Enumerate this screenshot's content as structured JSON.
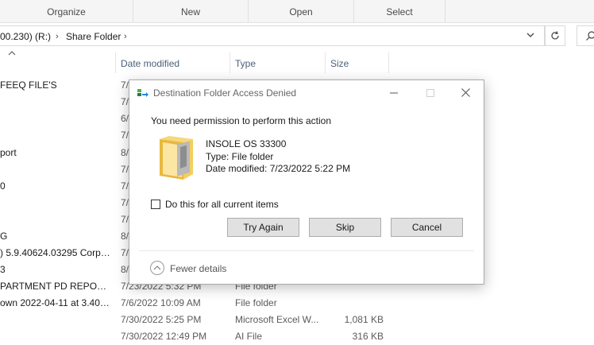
{
  "ribbon": {
    "groups": [
      "Organize",
      "New",
      "Open",
      "Select"
    ]
  },
  "address": {
    "drive_partial": "00.230) (R:)",
    "folder": "Share Folder"
  },
  "columns": {
    "date_modified": "Date modified",
    "type": "Type",
    "size": "Size"
  },
  "files": [
    {
      "name": "FEEQ FILE'S",
      "date": "7/",
      "type": "",
      "size": ""
    },
    {
      "name": "",
      "date": "7/",
      "type": "",
      "size": ""
    },
    {
      "name": "",
      "date": "6/",
      "type": "",
      "size": ""
    },
    {
      "name": "",
      "date": "7/",
      "type": "",
      "size": ""
    },
    {
      "name": "port",
      "date": "8/",
      "type": "",
      "size": ""
    },
    {
      "name": "",
      "date": "7/",
      "type": "",
      "size": ""
    },
    {
      "name": "0",
      "date": "7/",
      "type": "",
      "size": ""
    },
    {
      "name": "",
      "date": "7/",
      "type": "",
      "size": ""
    },
    {
      "name": "",
      "date": "7/",
      "type": "",
      "size": ""
    },
    {
      "name": "G",
      "date": "8/",
      "type": "",
      "size": ""
    },
    {
      "name": ") 5.9.40624.03295 Corpor...",
      "date": "7/",
      "type": "",
      "size": ""
    },
    {
      "name": "3",
      "date": "8/",
      "type": "",
      "size": ""
    },
    {
      "name": "PARTMENT PD REPORTI...",
      "date": "7/23/2022 5:32 PM",
      "type": "File folder",
      "size": ""
    },
    {
      "name": "own 2022-04-11 at 3.40.4...",
      "date": "7/6/2022 10:09 AM",
      "type": "File folder",
      "size": ""
    },
    {
      "name": "",
      "date": "7/30/2022 5:25 PM",
      "type": "Microsoft Excel W...",
      "size": "1,081 KB"
    },
    {
      "name": "",
      "date": "7/30/2022 12:49 PM",
      "type": "AI File",
      "size": "316 KB"
    }
  ],
  "dialog": {
    "title": "Destination Folder Access Denied",
    "message": "You need permission to perform this action",
    "item_name": "INSOLE  OS 33300",
    "item_type": "Type: File folder",
    "item_date": "Date modified: 7/23/2022 5:22 PM",
    "checkbox_label": "Do this for all current items",
    "checkbox_checked": false,
    "buttons": {
      "try_again": "Try Again",
      "skip": "Skip",
      "cancel": "Cancel"
    },
    "fewer_details": "Fewer details"
  },
  "icons": {
    "sort": "chevron-up-icon",
    "dropdown": "chevron-down-icon",
    "refresh": "refresh-icon",
    "search": "search-icon",
    "folder": "folder-icon",
    "app": "file-transfer-icon",
    "minimize": "minimize-icon",
    "maximize": "maximize-icon",
    "close": "close-icon",
    "collapse": "chevron-up-circle-icon"
  },
  "colors": {
    "column_header": "#4c6079",
    "button_bg": "#e1e1e1",
    "folder_yellow": "#f4cf5b"
  }
}
